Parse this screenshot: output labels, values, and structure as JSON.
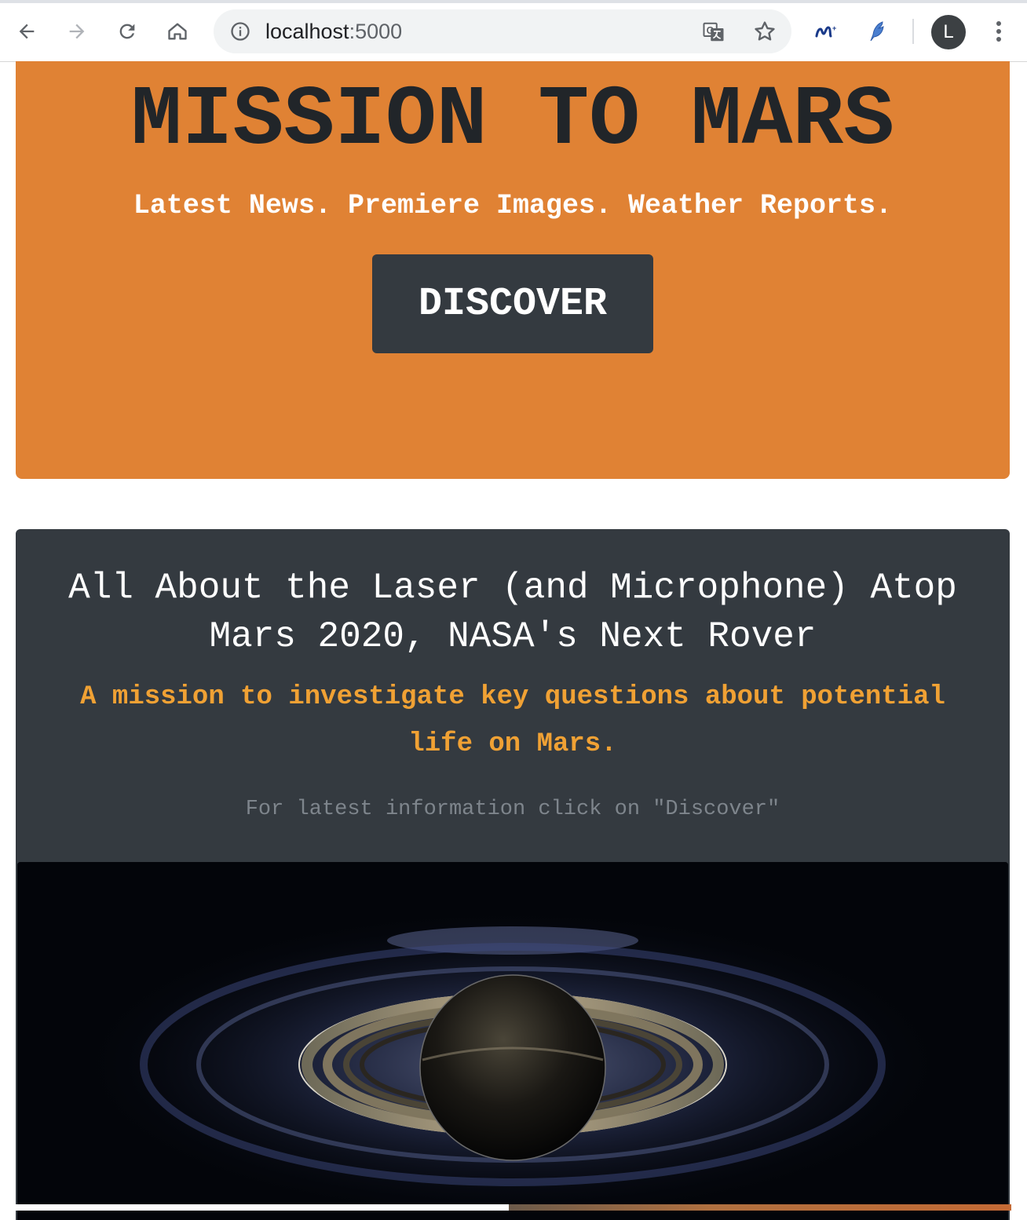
{
  "browser": {
    "url_host": "localhost",
    "url_port": ":5000",
    "profile_initial": "L",
    "icons": [
      "back-icon",
      "forward-icon",
      "reload-icon",
      "home-icon",
      "info-icon",
      "translate-icon",
      "star-icon",
      "movistar-extension-icon",
      "feather-extension-icon",
      "menu-icon"
    ]
  },
  "hero": {
    "title": "MISSION TO MARS",
    "tagline": "Latest News. Premiere Images. Weather Reports.",
    "button_label": "DISCOVER"
  },
  "news": {
    "title": "All About the Laser (and Microphone) Atop Mars 2020, NASA's Next Rover",
    "teaser": "A mission to investigate key questions about potential life on Mars.",
    "hint": "For latest information click on \"Discover\""
  },
  "colors": {
    "hero_bg": "#e08234",
    "card_bg": "#343a40",
    "teaser": "#f0a134"
  }
}
